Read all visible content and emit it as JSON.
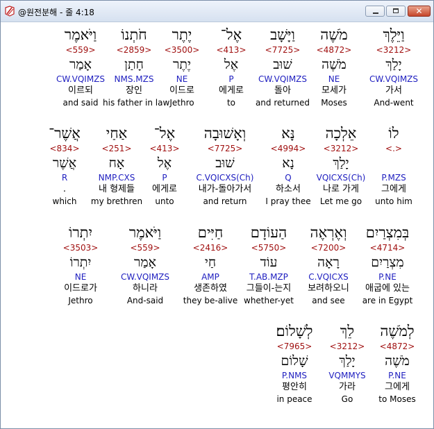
{
  "window": {
    "title": "@원전분해 - 줄 4:18",
    "close_label": "✕"
  },
  "rows": [
    {
      "words": [
        {
          "heb": "וַיֵּלֶךְ",
          "strong": "<3212>",
          "lemma": "יָלַךְ",
          "morph": "CW.VQIMZS",
          "kor": "가서",
          "eng": "And-went",
          "selected": true
        },
        {
          "heb": "מֹשֶׁה",
          "strong": "<4872>",
          "lemma": "מֹשֶׁה",
          "morph": "NE",
          "kor": "모세가",
          "eng": "Moses"
        },
        {
          "heb": "וַיָּשָׁב",
          "strong": "<7725>",
          "lemma": "שׁוּב",
          "morph": "CW.VQIMZS",
          "kor": "돌아",
          "eng": "and returned"
        },
        {
          "heb": "אֶל־",
          "strong": "<413>",
          "lemma": "אֶל",
          "morph": "P",
          "kor": "에게로",
          "eng": "to"
        },
        {
          "heb": "יֶתֶר",
          "strong": "<3500>",
          "lemma": "יֶתֶר",
          "morph": "NE",
          "kor": "이드로",
          "eng": "Jethro"
        },
        {
          "heb": "חֹתְנוֹ",
          "strong": "<2859>",
          "lemma": "חָתַן",
          "morph": "NMS.MZS",
          "kor": "장인",
          "eng": "his father in law"
        },
        {
          "heb": "וַיֹּאמֶר",
          "strong": "<559>",
          "lemma": "אָמַר",
          "morph": "CW.VQIMZS",
          "kor": "이르되",
          "eng": "and said"
        }
      ]
    },
    {
      "words": [
        {
          "heb": "לוֹ",
          "strong": "<.>",
          "lemma": "",
          "morph": "P.MZS",
          "kor": "그에게",
          "eng": "unto him"
        },
        {
          "heb": "אֵלְכָה",
          "strong": "<3212>",
          "lemma": "יָלַךְ",
          "morph": "VQICXS(Ch)",
          "kor": "나로 가게",
          "eng": "Let me go"
        },
        {
          "heb": "נָּא",
          "strong": "<4994>",
          "lemma": "נָא",
          "morph": "Q",
          "kor": "하소서",
          "eng": "I pray thee"
        },
        {
          "heb": "וְאָשׁוּבָה",
          "strong": "<7725>",
          "lemma": "שׁוּב",
          "morph": "C.VQICXS(Ch)",
          "kor": "내가-돌아가서",
          "eng": "and return"
        },
        {
          "heb": "אֶל־",
          "strong": "<413>",
          "lemma": "אֶל",
          "morph": "P",
          "kor": "에게로",
          "eng": "unto"
        },
        {
          "heb": "אַחַי",
          "strong": "<251>",
          "lemma": "אָח",
          "morph": "NMP.CXS",
          "kor": "내 형제들",
          "eng": "my brethren"
        },
        {
          "heb": "אֲשֶׁר־",
          "strong": "<834>",
          "lemma": "אֲשֶׁר",
          "morph": "R",
          "kor": ".",
          "eng": "which"
        }
      ]
    },
    {
      "words": [
        {
          "heb": "בְּמִצְרַיִם",
          "strong": "<4714>",
          "lemma": "מִצְרַיִם",
          "morph": "P.NE",
          "kor": "애굽에 있는",
          "eng": "are in Egypt"
        },
        {
          "heb": "וְאֶרְאֶה",
          "strong": "<7200>",
          "lemma": "רָאָה",
          "morph": "C.VQICXS",
          "kor": "보려하오니",
          "eng": "and see"
        },
        {
          "heb": "הַעוֹדָם",
          "strong": "<5750>",
          "lemma": "עוֹד",
          "morph": "T.AB.MZP",
          "kor": "그들이-는지",
          "eng": "whether-yet"
        },
        {
          "heb": "חַיִּים",
          "strong": "<2416>",
          "lemma": "חַי",
          "morph": "AMP",
          "kor": "생존하였",
          "eng": "they be-alive"
        },
        {
          "heb": "וַיֹּאמֶר",
          "strong": "<559>",
          "lemma": "אָמַר",
          "morph": "CW.VQIMZS",
          "kor": "하니라",
          "eng": "And-said"
        },
        {
          "heb": "יִתְרוֹ",
          "strong": "<3503>",
          "lemma": "יִתְרוֹ",
          "morph": "NE",
          "kor": "이드로가",
          "eng": "Jethro"
        }
      ]
    },
    {
      "words": [
        {
          "heb": "לְמֹשֶׁה",
          "strong": "<4872>",
          "lemma": "מֹשֶׁה",
          "morph": "P.NE",
          "kor": "그에게",
          "eng": "to Moses"
        },
        {
          "heb": "לֵךְ",
          "strong": "<3212>",
          "lemma": "יָלַךְ",
          "morph": "VQMMYS",
          "kor": "가라",
          "eng": "Go"
        },
        {
          "heb": "לְשָׁלוֹם׃",
          "strong": "<7965>",
          "lemma": "שָׁלוֹם",
          "morph": "P.NMS",
          "kor": "평안히",
          "eng": "in peace"
        }
      ]
    }
  ]
}
